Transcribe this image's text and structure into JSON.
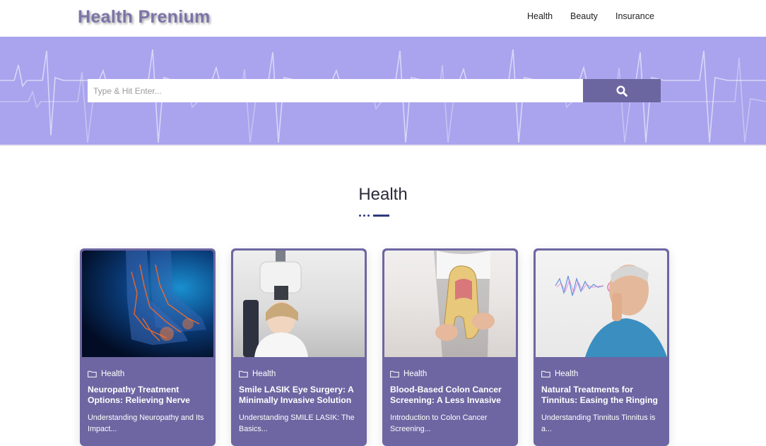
{
  "header": {
    "logo": "Health Prenium",
    "nav": [
      "Health",
      "Beauty",
      "Insurance"
    ]
  },
  "search": {
    "placeholder": "Type & Hit Enter..."
  },
  "section": {
    "title": "Health"
  },
  "colors": {
    "accent": "#6d66a2",
    "hero_bg": "#aaa4ee",
    "divider": "#2f3a7d"
  },
  "cards": [
    {
      "category": "Health",
      "title": "Neuropathy Treatment Options: Relieving Nerve Pain",
      "excerpt": "Understanding Neuropathy and Its Impact..."
    },
    {
      "category": "Health",
      "title": "Smile LASIK Eye Surgery: A Minimally Invasive Solution",
      "excerpt": "Understanding SMILE LASIK: The Basics..."
    },
    {
      "category": "Health",
      "title": "Blood-Based Colon Cancer Screening: A Less Invasive Option",
      "excerpt": "Introduction to Colon Cancer Screening..."
    },
    {
      "category": "Health",
      "title": "Natural Treatments for Tinnitus: Easing the Ringing",
      "excerpt": "Understanding Tinnitus Tinnitus is a..."
    }
  ]
}
